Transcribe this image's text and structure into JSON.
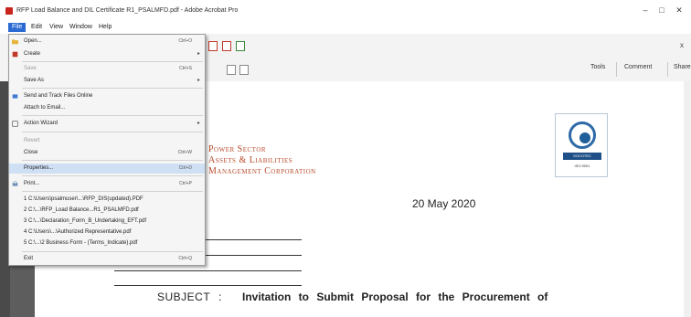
{
  "window": {
    "title": "RFP Load Balance and DIL Certificate R1_PSALMFD.pdf - Adobe Acrobat Pro",
    "min_glyph": "–",
    "max_glyph": "□",
    "close_glyph": "✕"
  },
  "menubar": {
    "items": [
      "File",
      "Edit",
      "View",
      "Window",
      "Help"
    ]
  },
  "toolbar": {
    "tools_label": "Tools",
    "comment_label": "Comment",
    "share_label": "Share",
    "close_glyph": "x"
  },
  "file_menu": {
    "items": [
      {
        "label": "Open...",
        "shortcut": "Ctrl+O",
        "icon": "folder-icon",
        "submenu": false,
        "disabled": false
      },
      {
        "label": "Create",
        "shortcut": "",
        "icon": "create-icon",
        "submenu": true,
        "disabled": false
      },
      {
        "label": "Save",
        "shortcut": "Ctrl+S",
        "icon": "",
        "submenu": false,
        "disabled": true
      },
      {
        "label": "Save As",
        "shortcut": "",
        "icon": "",
        "submenu": true,
        "disabled": false
      },
      {
        "label": "Send and Track Files Online",
        "shortcut": "",
        "icon": "send-icon",
        "submenu": false,
        "disabled": false
      },
      {
        "label": "Attach to Email...",
        "shortcut": "",
        "icon": "",
        "submenu": false,
        "disabled": false
      },
      {
        "label": "Action Wizard",
        "shortcut": "",
        "icon": "wizard-icon",
        "submenu": true,
        "disabled": false
      },
      {
        "label": "Revert",
        "shortcut": "",
        "icon": "",
        "submenu": false,
        "disabled": true
      },
      {
        "label": "Close",
        "shortcut": "Ctrl+W",
        "icon": "",
        "submenu": false,
        "disabled": false
      },
      {
        "label": "Properties...",
        "shortcut": "Ctrl+D",
        "icon": "",
        "submenu": false,
        "disabled": false,
        "highlight": true
      },
      {
        "label": "Print...",
        "shortcut": "Ctrl+P",
        "icon": "print-icon",
        "submenu": false,
        "disabled": false
      },
      {
        "label": "1 C:\\Users\\psalmuser\\...\\RFP_DIS(updated).PDF",
        "shortcut": "",
        "icon": "",
        "submenu": false,
        "disabled": false
      },
      {
        "label": "2 C:\\...\\RFP_Load Balance...R1_PSALMFD.pdf",
        "shortcut": "",
        "icon": "",
        "submenu": false,
        "disabled": false
      },
      {
        "label": "3 C:\\...\\Declaration_Form_B_Undertaking_EFT.pdf",
        "shortcut": "",
        "icon": "",
        "submenu": false,
        "disabled": false
      },
      {
        "label": "4 C:\\Users\\...\\Authorized Representative.pdf",
        "shortcut": "",
        "icon": "",
        "submenu": false,
        "disabled": false
      },
      {
        "label": "5 C:\\...\\2 Business Form - (Terms_Indicate).pdf",
        "shortcut": "",
        "icon": "",
        "submenu": false,
        "disabled": false
      },
      {
        "label": "Exit",
        "shortcut": "Ctrl+Q",
        "icon": "",
        "submenu": false,
        "disabled": false
      }
    ]
  },
  "document": {
    "org_lines": [
      "Power Sector",
      "Assets & Liabilities",
      "Management Corporation"
    ],
    "logo_text": "SOCOTEC",
    "logo_caption": "ISO 9001",
    "date": "20 May 2020",
    "subject_label": "SUBJECT",
    "subject_colon": ":",
    "subject_text": "Invitation to Submit Proposal for the Procurement of"
  },
  "colors": {
    "menu_active": "#2a6ad2",
    "org_text": "#b84a2a",
    "logo_blue": "#1e4f86",
    "highlight": "#cfe0f5"
  }
}
